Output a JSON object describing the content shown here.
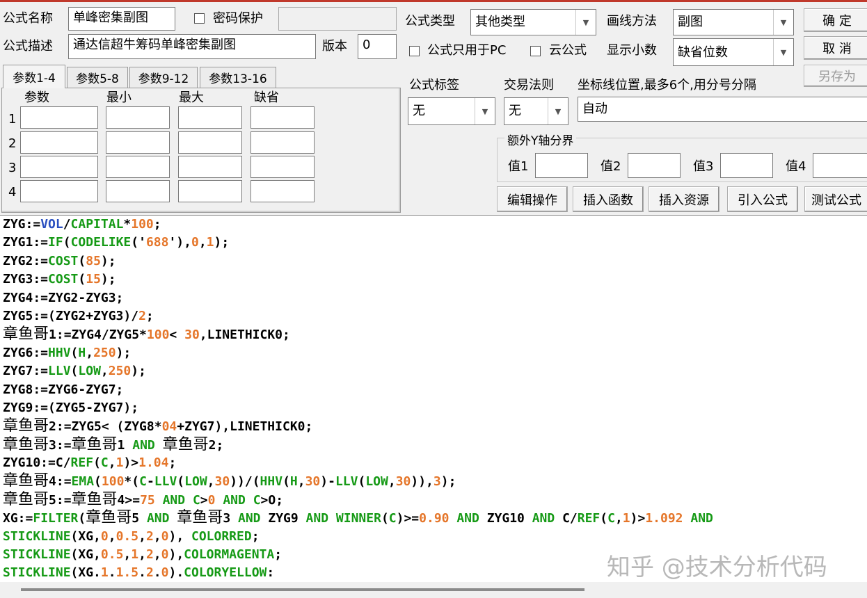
{
  "header": {
    "name_label": "公式名称",
    "name_value": "单峰密集副图",
    "password_label": "密码保护",
    "desc_label": "公式描述",
    "desc_value": "通达信超牛筹码单峰密集副图",
    "version_label": "版本",
    "version_value": "0",
    "type_label": "公式类型",
    "type_value": "其他类型",
    "draw_label": "画线方法",
    "draw_value": "副图",
    "pc_only_label": "公式只用于PC",
    "cloud_label": "云公式",
    "decimals_label": "显示小数",
    "decimals_value": "缺省位数",
    "tag_label": "公式标签",
    "tag_value": "无",
    "trade_label": "交易法则",
    "trade_value": "无",
    "axis_label": "坐标线位置,最多6个,用分号分隔",
    "axis_value": "自动"
  },
  "buttons": {
    "ok": "确  定",
    "cancel": "取  消",
    "save_as": "另存为",
    "edit_ops": "编辑操作",
    "insert_func": "插入函数",
    "insert_res": "插入资源",
    "import_formula": "引入公式",
    "test_formula": "测试公式"
  },
  "tabs": [
    "参数1-4",
    "参数5-8",
    "参数9-12",
    "参数13-16"
  ],
  "params": {
    "headers": [
      "参数",
      "最小",
      "最大",
      "缺省"
    ],
    "rows": [
      "1",
      "2",
      "3",
      "4"
    ]
  },
  "extra_y": {
    "title": "额外Y轴分界",
    "labels": [
      "值1",
      "值2",
      "值3",
      "值4"
    ]
  },
  "code_lines": [
    [
      [
        "ZYG:=",
        "k"
      ],
      [
        "VOL",
        "v"
      ],
      [
        "/",
        "k"
      ],
      [
        "CAPITAL",
        "f"
      ],
      [
        "*",
        "k"
      ],
      [
        "100",
        "n"
      ],
      [
        ";",
        "k"
      ]
    ],
    [
      [
        "ZYG1:=",
        "k"
      ],
      [
        "IF",
        "f"
      ],
      [
        "(",
        "k"
      ],
      [
        "CODELIKE",
        "f"
      ],
      [
        "('",
        "k"
      ],
      [
        "688",
        "n"
      ],
      [
        "'),",
        "k"
      ],
      [
        "0",
        "n"
      ],
      [
        ",",
        "k"
      ],
      [
        "1",
        "n"
      ],
      [
        ");",
        "k"
      ]
    ],
    [
      [
        "ZYG2:=",
        "k"
      ],
      [
        "COST",
        "f"
      ],
      [
        "(",
        "k"
      ],
      [
        "85",
        "n"
      ],
      [
        ");",
        "k"
      ]
    ],
    [
      [
        "ZYG3:=",
        "k"
      ],
      [
        "COST",
        "f"
      ],
      [
        "(",
        "k"
      ],
      [
        "15",
        "n"
      ],
      [
        ");",
        "k"
      ]
    ],
    [
      [
        "ZYG4:=ZYG2-ZYG3;",
        "k"
      ]
    ],
    [
      [
        "ZYG5:=(ZYG2+ZYG3)/",
        "k"
      ],
      [
        "2",
        "n"
      ],
      [
        ";",
        "k"
      ]
    ],
    [
      [
        "章鱼哥",
        "c"
      ],
      [
        "1:=ZYG4/ZYG5*",
        "k"
      ],
      [
        "100",
        "n"
      ],
      [
        "< ",
        "k"
      ],
      [
        "30",
        "n"
      ],
      [
        ",LINETHICK0;",
        "k"
      ]
    ],
    [
      [
        "ZYG6:=",
        "k"
      ],
      [
        "HHV",
        "f"
      ],
      [
        "(",
        "k"
      ],
      [
        "H",
        "f"
      ],
      [
        ",",
        "k"
      ],
      [
        "250",
        "n"
      ],
      [
        ");",
        "k"
      ]
    ],
    [
      [
        "ZYG7:=",
        "k"
      ],
      [
        "LLV",
        "f"
      ],
      [
        "(",
        "k"
      ],
      [
        "LOW",
        "f"
      ],
      [
        ",",
        "k"
      ],
      [
        "250",
        "n"
      ],
      [
        ");",
        "k"
      ]
    ],
    [
      [
        "ZYG8:=ZYG6-ZYG7;",
        "k"
      ]
    ],
    [
      [
        "ZYG9:=(ZYG5-ZYG7);",
        "k"
      ]
    ],
    [
      [
        "章鱼哥",
        "c"
      ],
      [
        "2:=ZYG5< (ZYG8*",
        "k"
      ],
      [
        "04",
        "n"
      ],
      [
        "+ZYG7),LINETHICK0;",
        "k"
      ]
    ],
    [
      [
        "章鱼哥",
        "c"
      ],
      [
        "3:=",
        "k"
      ],
      [
        "章鱼哥",
        "c"
      ],
      [
        "1 ",
        "k"
      ],
      [
        "AND",
        "f"
      ],
      [
        " ",
        "k"
      ],
      [
        "章鱼哥",
        "c"
      ],
      [
        "2;",
        "k"
      ]
    ],
    [
      [
        "ZYG10:=C/",
        "k"
      ],
      [
        "REF",
        "f"
      ],
      [
        "(",
        "k"
      ],
      [
        "C",
        "f"
      ],
      [
        ",",
        "k"
      ],
      [
        "1",
        "n"
      ],
      [
        ")>",
        "k"
      ],
      [
        "1.04",
        "n"
      ],
      [
        ";",
        "k"
      ]
    ],
    [
      [
        "章鱼哥",
        "c"
      ],
      [
        "4:=",
        "k"
      ],
      [
        "EMA",
        "f"
      ],
      [
        "(",
        "k"
      ],
      [
        "100",
        "n"
      ],
      [
        "*(",
        "k"
      ],
      [
        "C",
        "f"
      ],
      [
        "-",
        "k"
      ],
      [
        "LLV",
        "f"
      ],
      [
        "(",
        "k"
      ],
      [
        "LOW",
        "f"
      ],
      [
        ",",
        "k"
      ],
      [
        "30",
        "n"
      ],
      [
        "))/(",
        "k"
      ],
      [
        "HHV",
        "f"
      ],
      [
        "(",
        "k"
      ],
      [
        "H",
        "f"
      ],
      [
        ",",
        "k"
      ],
      [
        "30",
        "n"
      ],
      [
        ")-",
        "k"
      ],
      [
        "LLV",
        "f"
      ],
      [
        "(",
        "k"
      ],
      [
        "LOW",
        "f"
      ],
      [
        ",",
        "k"
      ],
      [
        "30",
        "n"
      ],
      [
        ")),",
        "k"
      ],
      [
        "3",
        "n"
      ],
      [
        ");",
        "k"
      ]
    ],
    [
      [
        "章鱼哥",
        "c"
      ],
      [
        "5:=",
        "k"
      ],
      [
        "章鱼哥",
        "c"
      ],
      [
        "4>=",
        "k"
      ],
      [
        "75",
        "n"
      ],
      [
        " ",
        "k"
      ],
      [
        "AND",
        "f"
      ],
      [
        " ",
        "k"
      ],
      [
        "C",
        "f"
      ],
      [
        ">",
        "k"
      ],
      [
        "0",
        "n"
      ],
      [
        " ",
        "k"
      ],
      [
        "AND",
        "f"
      ],
      [
        " ",
        "k"
      ],
      [
        "C",
        "f"
      ],
      [
        ">O;",
        "k"
      ]
    ],
    [
      [
        "XG:=",
        "k"
      ],
      [
        "FILTER",
        "f"
      ],
      [
        "(",
        "k"
      ],
      [
        "章鱼哥",
        "c"
      ],
      [
        "5 ",
        "k"
      ],
      [
        "AND",
        "f"
      ],
      [
        " ",
        "k"
      ],
      [
        "章鱼哥",
        "c"
      ],
      [
        "3 ",
        "k"
      ],
      [
        "AND",
        "f"
      ],
      [
        " ZYG9 ",
        "k"
      ],
      [
        "AND",
        "f"
      ],
      [
        " ",
        "k"
      ],
      [
        "WINNER",
        "f"
      ],
      [
        "(",
        "k"
      ],
      [
        "C",
        "f"
      ],
      [
        ")>=",
        "k"
      ],
      [
        "0.90",
        "n"
      ],
      [
        " ",
        "k"
      ],
      [
        "AND",
        "f"
      ],
      [
        " ZYG10 ",
        "k"
      ],
      [
        "AND",
        "f"
      ],
      [
        " C/",
        "k"
      ],
      [
        "REF",
        "f"
      ],
      [
        "(",
        "k"
      ],
      [
        "C",
        "f"
      ],
      [
        ",",
        "k"
      ],
      [
        "1",
        "n"
      ],
      [
        ")>",
        "k"
      ],
      [
        "1.092",
        "n"
      ],
      [
        " ",
        "k"
      ],
      [
        "AND",
        "f"
      ]
    ],
    [
      [
        "STICKLINE",
        "f"
      ],
      [
        "(XG,",
        "k"
      ],
      [
        "0",
        "n"
      ],
      [
        ",",
        "k"
      ],
      [
        "0.5",
        "n"
      ],
      [
        ",",
        "k"
      ],
      [
        "2",
        "n"
      ],
      [
        ",",
        "k"
      ],
      [
        "0",
        "n"
      ],
      [
        "), ",
        "k"
      ],
      [
        "COLORRED",
        "f"
      ],
      [
        ";",
        "k"
      ]
    ],
    [
      [
        "STICKLINE",
        "f"
      ],
      [
        "(XG,",
        "k"
      ],
      [
        "0.5",
        "n"
      ],
      [
        ",",
        "k"
      ],
      [
        "1",
        "n"
      ],
      [
        ",",
        "k"
      ],
      [
        "2",
        "n"
      ],
      [
        ",",
        "k"
      ],
      [
        "0",
        "n"
      ],
      [
        "),",
        "k"
      ],
      [
        "COLORMAGENTA",
        "f"
      ],
      [
        ";",
        "k"
      ]
    ],
    [
      [
        "STICKLINE",
        "f"
      ],
      [
        "(XG.",
        "k"
      ],
      [
        "1",
        "n"
      ],
      [
        ".",
        "k"
      ],
      [
        "1.5",
        "n"
      ],
      [
        ".",
        "k"
      ],
      [
        "2",
        "n"
      ],
      [
        ".",
        "k"
      ],
      [
        "0",
        "n"
      ],
      [
        ").",
        "k"
      ],
      [
        "COLORYELLOW",
        "f"
      ],
      [
        ":",
        "k"
      ]
    ]
  ],
  "watermark": "知乎 @技术分析代码",
  "colors": {
    "keyword": "#000000",
    "function": "#169a16",
    "number": "#e5762a",
    "variable": "#2a4fc0"
  }
}
